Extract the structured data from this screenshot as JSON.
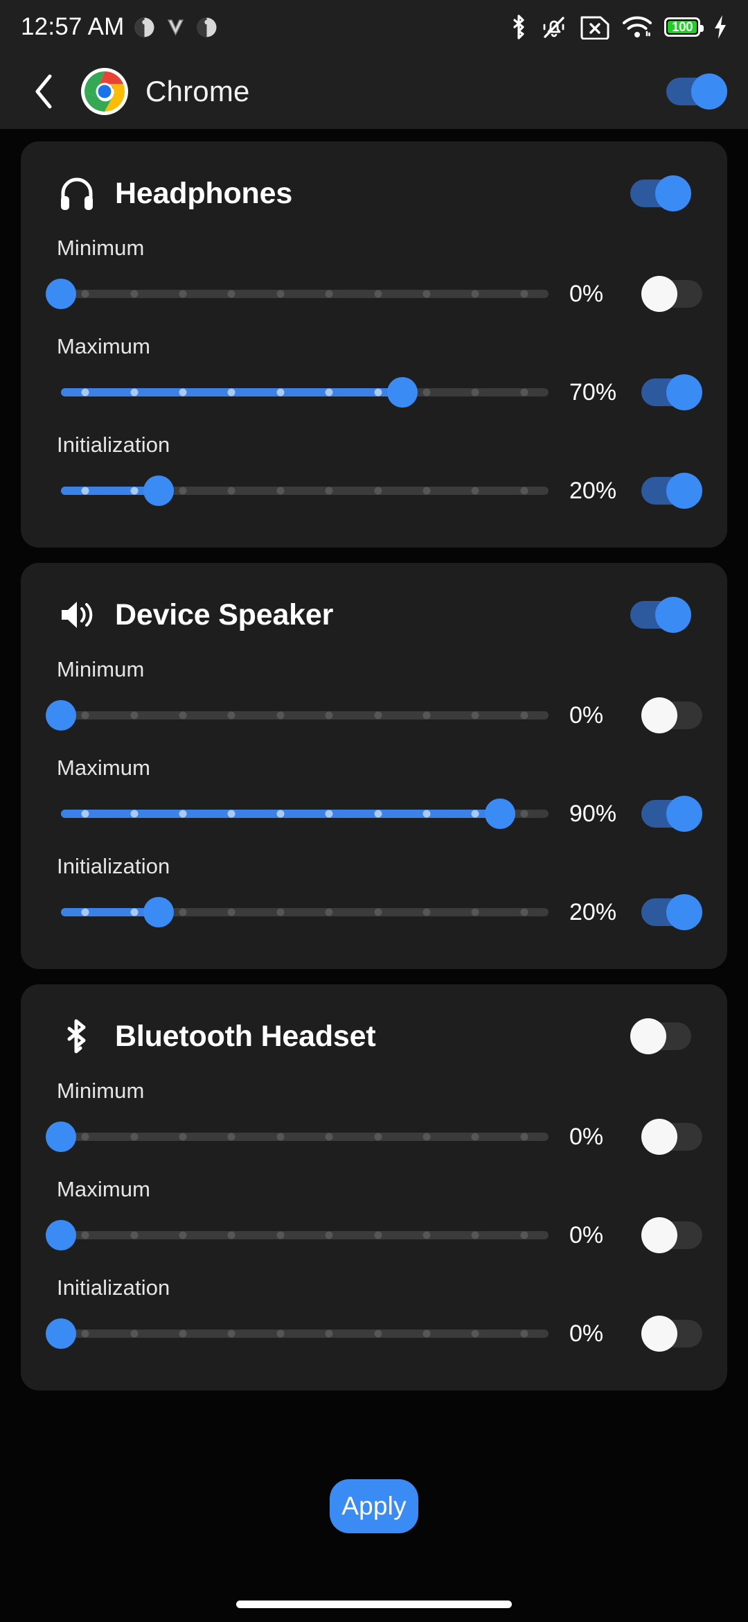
{
  "statusbar": {
    "time": "12:57 AM",
    "app_icons": [
      "app-badge-icon",
      "v-app-icon",
      "app-badge-icon"
    ],
    "right_icons": [
      "bluetooth-icon",
      "vibrate-off-icon",
      "sim-card-missing-icon",
      "wifi-icon",
      "battery-icon",
      "charging-bolt-icon"
    ],
    "battery_level": "100",
    "battery_color": "#1fd024"
  },
  "appbar": {
    "back_label": "Back",
    "app_name": "Chrome",
    "logo": "chrome-logo-icon",
    "master_toggle": "on"
  },
  "theme": {
    "accent": "#3b8bf5",
    "track_on": "#2d5a9e",
    "track_off": "#343434",
    "slider_fill": "#3b82e8",
    "card_bg": "#1e1e1e",
    "page_bg": "#050505"
  },
  "cards": [
    {
      "id": "headphones",
      "icon": "headphones-icon",
      "title": "Headphones",
      "enabled": true,
      "rows": [
        {
          "label": "Minimum",
          "value": 0,
          "value_text": "0%",
          "toggle": false
        },
        {
          "label": "Maximum",
          "value": 70,
          "value_text": "70%",
          "toggle": true
        },
        {
          "label": "Initialization",
          "value": 20,
          "value_text": "20%",
          "toggle": true
        }
      ]
    },
    {
      "id": "device-speaker",
      "icon": "speaker-icon",
      "title": "Device Speaker",
      "enabled": true,
      "rows": [
        {
          "label": "Minimum",
          "value": 0,
          "value_text": "0%",
          "toggle": false
        },
        {
          "label": "Maximum",
          "value": 90,
          "value_text": "90%",
          "toggle": true
        },
        {
          "label": "Initialization",
          "value": 20,
          "value_text": "20%",
          "toggle": true
        }
      ]
    },
    {
      "id": "bluetooth-headset",
      "icon": "bluetooth-icon",
      "title": "Bluetooth Headset",
      "enabled": false,
      "rows": [
        {
          "label": "Minimum",
          "value": 0,
          "value_text": "0%",
          "toggle": false
        },
        {
          "label": "Maximum",
          "value": 0,
          "value_text": "0%",
          "toggle": false
        },
        {
          "label": "Initialization",
          "value": 0,
          "value_text": "0%",
          "toggle": false
        }
      ]
    }
  ],
  "apply": {
    "label": "Apply"
  },
  "slider_ticks": 10
}
